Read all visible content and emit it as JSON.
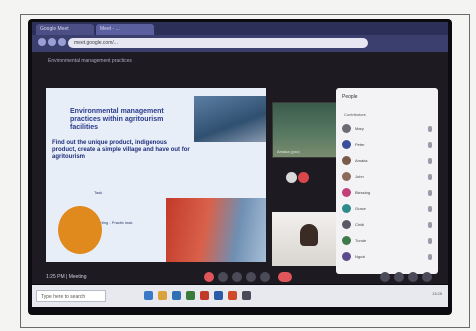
{
  "browser": {
    "tab1": "Google Meet",
    "tab2": "Meet - ...",
    "address": "meet.google.com/...",
    "meeting_header": "Environmental management practices"
  },
  "slide": {
    "title": "Environmental management practices within agritourism facilities",
    "body": "Find out the unique product, indigenous product, create a simple village and have out for agritourism",
    "small_label": "Task",
    "note": "Meeting - Practic task"
  },
  "tiles": {
    "top_label": "Amaka (you)"
  },
  "people_panel": {
    "title": "People",
    "section": "Contributors",
    "names": [
      "Mary",
      "Peter",
      "Amaka",
      "John",
      "Blessing",
      "Grace",
      "Chidi",
      "Tunde",
      "Ngozi"
    ]
  },
  "meeting_bar": {
    "time_label": "1:25 PM | Meeting"
  },
  "taskbar": {
    "search_placeholder": "Type here to search",
    "tray_time": "13:25"
  },
  "icons": [
    "back-icon",
    "forward-icon",
    "reload-icon",
    "mic-icon",
    "camera-icon",
    "present-icon",
    "hangup-icon",
    "search-icon"
  ]
}
